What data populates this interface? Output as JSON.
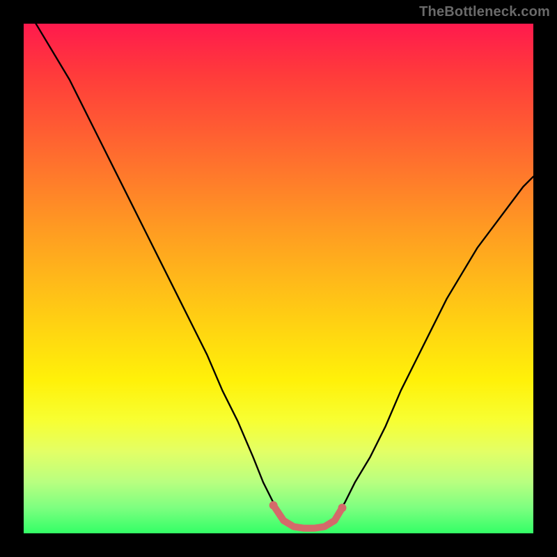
{
  "watermark": "TheBottleneck.com",
  "chart_data": {
    "type": "line",
    "title": "",
    "xlabel": "",
    "ylabel": "",
    "xlim": [
      0,
      100
    ],
    "ylim": [
      0,
      100
    ],
    "grid": false,
    "series": [
      {
        "name": "bottleneck-curve",
        "color": "#000000",
        "x": [
          0,
          3,
          6,
          9,
          12,
          15,
          18,
          21,
          24,
          27,
          30,
          33,
          36,
          39,
          42,
          45,
          47,
          49,
          51,
          53,
          55,
          57,
          59,
          61,
          63,
          65,
          68,
          71,
          74,
          77,
          80,
          83,
          86,
          89,
          92,
          95,
          98,
          100
        ],
        "values": [
          104,
          99,
          94,
          89,
          83,
          77,
          71,
          65,
          59,
          53,
          47,
          41,
          35,
          28,
          22,
          15,
          10,
          6,
          3,
          1.5,
          1,
          1,
          1.5,
          3,
          6,
          10,
          15,
          21,
          28,
          34,
          40,
          46,
          51,
          56,
          60,
          64,
          68,
          70
        ]
      },
      {
        "name": "optimal-zone-marker",
        "color": "#d46a6a",
        "x": [
          49,
          51,
          53,
          55,
          57,
          59,
          61,
          62.5
        ],
        "values": [
          5.5,
          2.5,
          1.3,
          1,
          1,
          1.3,
          2.5,
          5
        ]
      }
    ],
    "annotations": []
  }
}
